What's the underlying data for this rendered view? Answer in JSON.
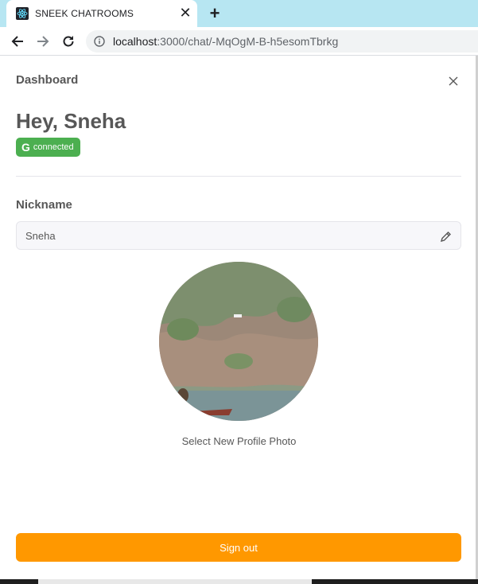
{
  "browser": {
    "tab_title": "SNEEK CHATROOMS",
    "tab_close_glyph": "✕",
    "new_tab_glyph": "+",
    "url_host": "localhost",
    "url_path": ":3000/chat/-MqOgM-B-h5esomTbrkg",
    "icons": [
      "react-favicon-icon",
      "back-arrow-icon",
      "forward-arrow-icon",
      "reload-icon",
      "info-icon",
      "close-icon"
    ]
  },
  "modal": {
    "title": "Dashboard",
    "greeting": "Hey, Sneha",
    "badge": {
      "provider_glyph": "G",
      "label": "connected",
      "color": "#4caf50"
    },
    "nickname": {
      "label": "Nickname",
      "value": "Sneha",
      "edit_icon": "pencil-icon"
    },
    "avatar_caption": "Select New Profile Photo",
    "signout_label": "Sign out",
    "accent_color": "#ff9800"
  }
}
